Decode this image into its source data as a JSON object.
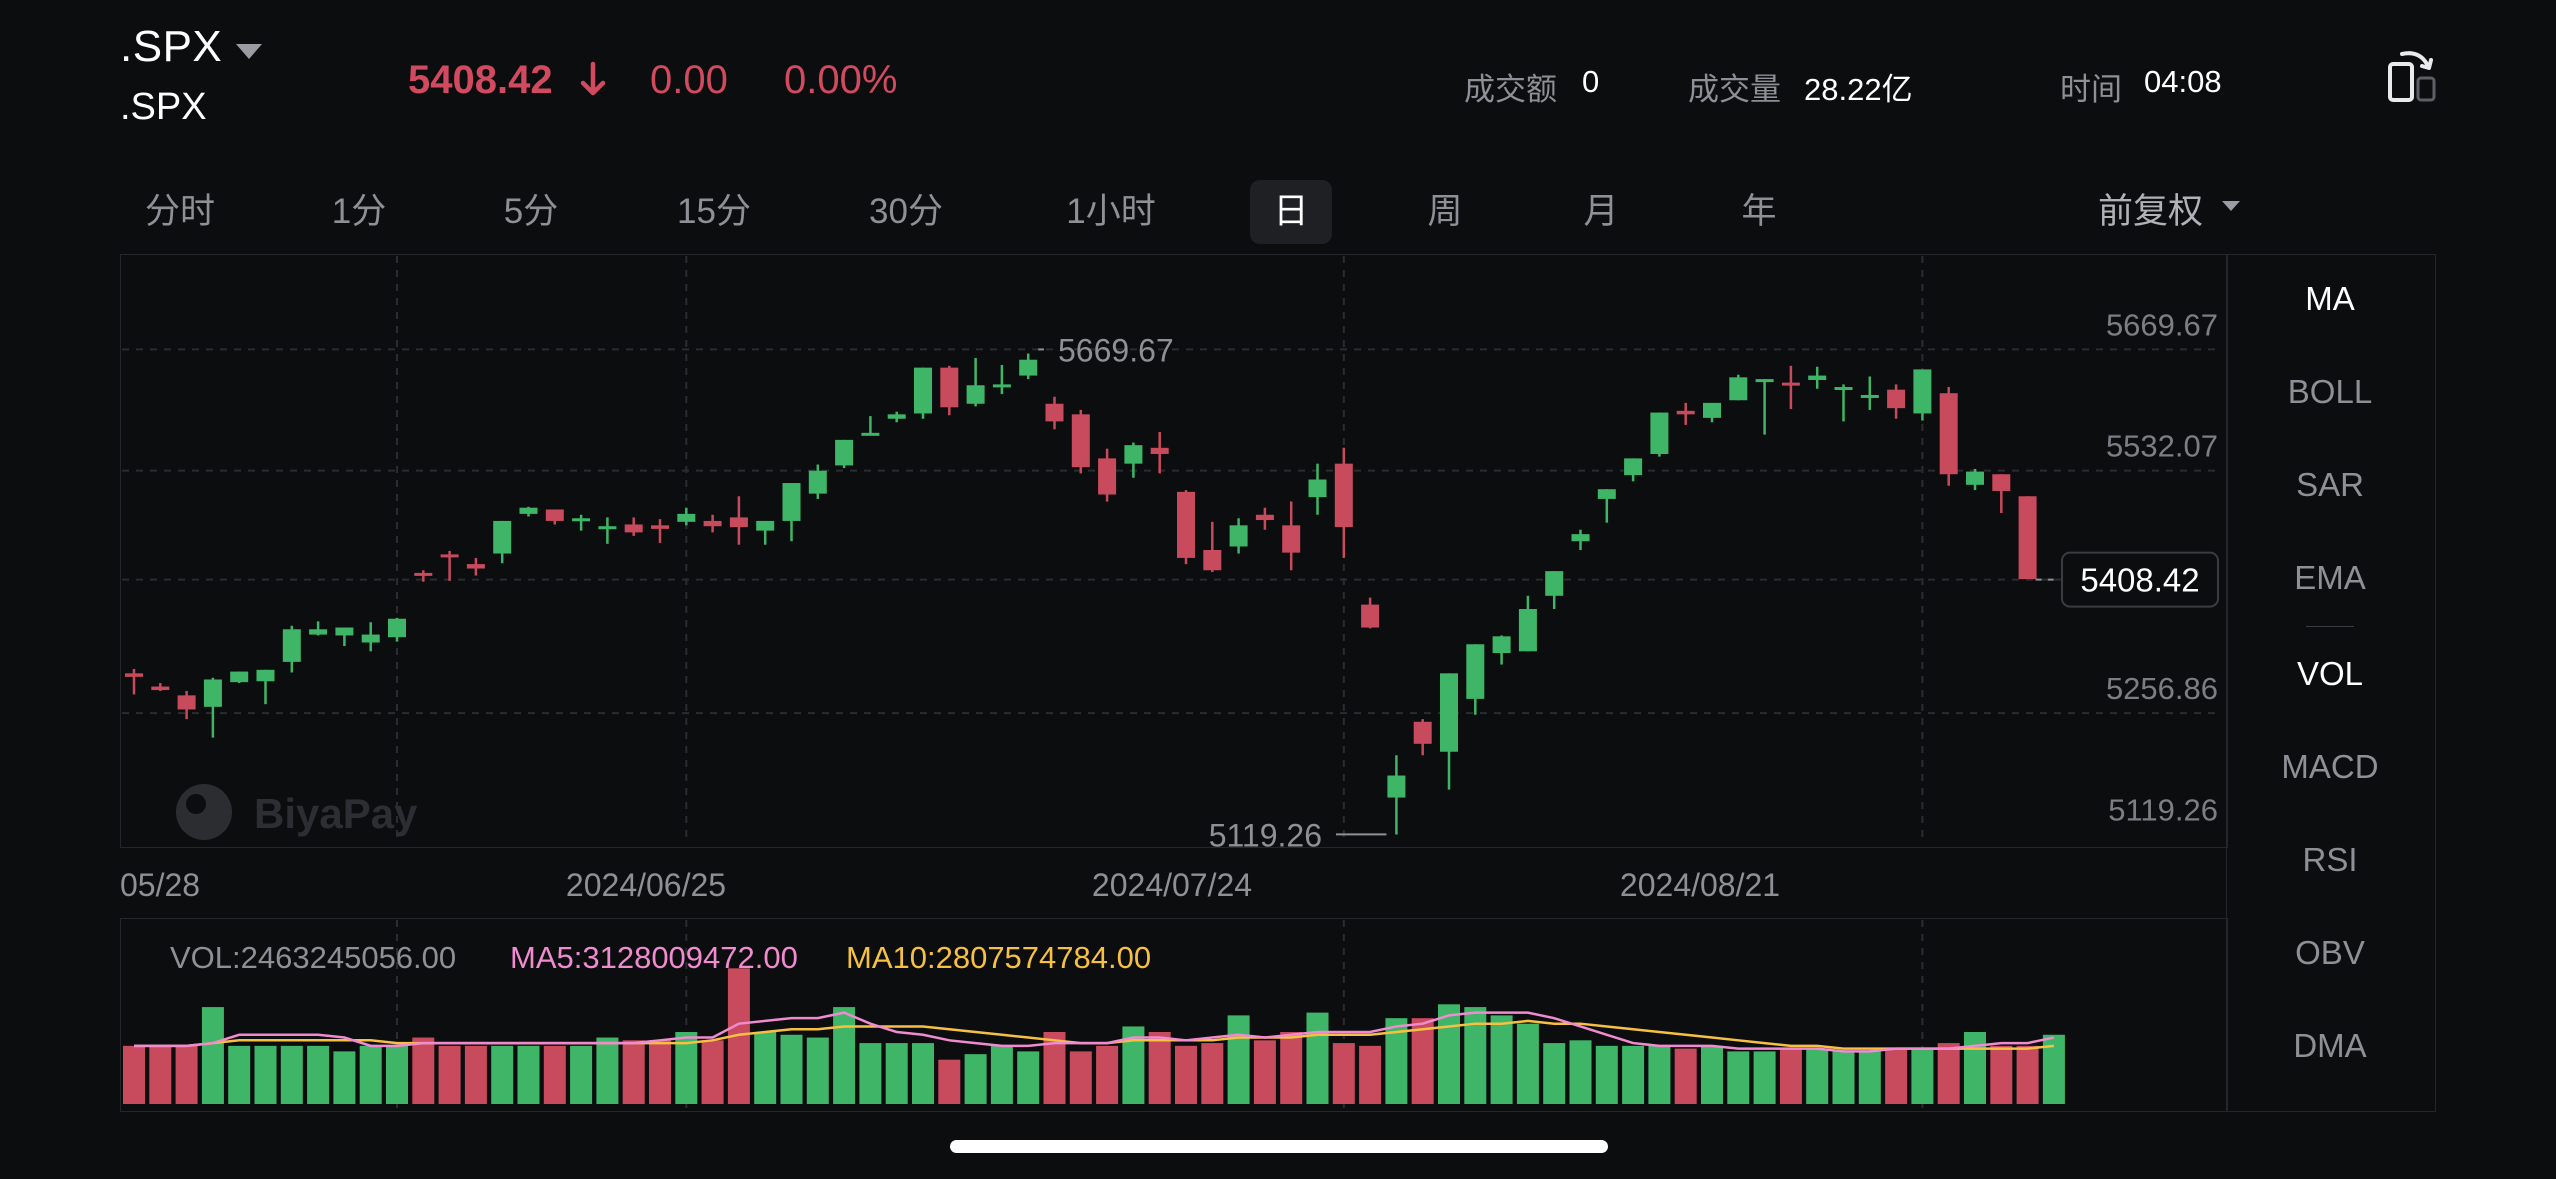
{
  "header": {
    "symbol": ".SPX",
    "symbol_sub": ".SPX",
    "price": "5408.42",
    "change": "0.00",
    "change_pct": "0.00%",
    "turnover_label": "成交额",
    "turnover_value": "0",
    "volume_label": "成交量",
    "volume_value": "28.22亿",
    "time_label": "时间",
    "time_value": "04:08"
  },
  "tabs": [
    {
      "label": "分时"
    },
    {
      "label": "1分"
    },
    {
      "label": "5分"
    },
    {
      "label": "15分"
    },
    {
      "label": "30分"
    },
    {
      "label": "1小时"
    },
    {
      "label": "日",
      "active": true
    },
    {
      "label": "周"
    },
    {
      "label": "月"
    },
    {
      "label": "年"
    }
  ],
  "adjust_label": "前复权",
  "indicators": {
    "main": [
      "MA",
      "BOLL",
      "SAR",
      "EMA"
    ],
    "sub": [
      "VOL",
      "MACD",
      "RSI",
      "OBV",
      "DMA"
    ]
  },
  "watermark": "BiyaPay",
  "vol_legend": {
    "vol": "VOL:2463245056.00",
    "ma5": "MA5:3128009472.00",
    "ma10": "MA10:2807574784.00"
  },
  "colors": {
    "up": "#3fb667",
    "down": "#c84a5d",
    "ma5": "#f08bd0",
    "ma10": "#f6c042",
    "background": "#0c0d0f"
  },
  "chart_data": {
    "type": "candlestick",
    "y_ticks": [
      "5669.67",
      "5532.07",
      "5408.42",
      "5256.86",
      "5119.26"
    ],
    "x_ticks": [
      "05/28",
      "2024/06/25",
      "2024/07/24",
      "2024/08/21"
    ],
    "high_marker": "5669.67",
    "low_marker": "5119.26",
    "last_price": "5408.42",
    "ylim": [
      5106,
      5778
    ],
    "candles": [
      [
        5302,
        5307,
        5278,
        5298
      ],
      [
        5287,
        5291,
        5282,
        5283
      ],
      [
        5277,
        5282,
        5250,
        5261
      ],
      [
        5264,
        5297,
        5229,
        5295
      ],
      [
        5292,
        5303,
        5291,
        5304
      ],
      [
        5293,
        5304,
        5267,
        5306
      ],
      [
        5315,
        5356,
        5303,
        5352
      ],
      [
        5346,
        5361,
        5345,
        5352
      ],
      [
        5345,
        5349,
        5333,
        5354
      ],
      [
        5337,
        5360,
        5327,
        5346
      ],
      [
        5343,
        5365,
        5338,
        5364
      ],
      [
        5416,
        5419,
        5406,
        5414
      ],
      [
        5437,
        5441,
        5407,
        5435
      ],
      [
        5426,
        5433,
        5413,
        5421
      ],
      [
        5438,
        5474,
        5427,
        5475
      ],
      [
        5483,
        5491,
        5480,
        5490
      ],
      [
        5488,
        5487,
        5471,
        5475
      ],
      [
        5477,
        5482,
        5464,
        5478
      ],
      [
        5466,
        5479,
        5449,
        5469
      ],
      [
        5471,
        5479,
        5458,
        5462
      ],
      [
        5470,
        5477,
        5450,
        5466
      ],
      [
        5474,
        5490,
        5470,
        5483
      ],
      [
        5475,
        5482,
        5462,
        5469
      ],
      [
        5479,
        5503,
        5448,
        5468
      ],
      [
        5464,
        5473,
        5448,
        5475
      ],
      [
        5475,
        5492,
        5452,
        5518
      ],
      [
        5506,
        5539,
        5500,
        5532
      ],
      [
        5538,
        5565,
        5535,
        5567
      ],
      [
        5574,
        5594,
        5585,
        5575
      ],
      [
        5591,
        5599,
        5587,
        5596
      ],
      [
        5597,
        5615,
        5591,
        5649
      ],
      [
        5649,
        5651,
        5595,
        5604
      ],
      [
        5608,
        5660,
        5605,
        5629
      ],
      [
        5630,
        5652,
        5619,
        5630
      ],
      [
        5640,
        5665,
        5636,
        5658
      ],
      [
        5608,
        5616,
        5579,
        5588
      ],
      [
        5596,
        5601,
        5529,
        5536
      ],
      [
        5546,
        5557,
        5497,
        5505
      ],
      [
        5540,
        5564,
        5524,
        5561
      ],
      [
        5558,
        5576,
        5529,
        5551
      ],
      [
        5508,
        5510,
        5426,
        5433
      ],
      [
        5442,
        5474,
        5417,
        5419
      ],
      [
        5446,
        5478,
        5438,
        5470
      ],
      [
        5482,
        5490,
        5465,
        5476
      ],
      [
        5470,
        5497,
        5419,
        5439
      ],
      [
        5502,
        5540,
        5482,
        5522
      ],
      [
        5540,
        5558,
        5433,
        5468
      ],
      [
        5380,
        5388,
        5353,
        5354
      ],
      [
        5161,
        5209,
        5119,
        5186
      ],
      [
        5247,
        5250,
        5209,
        5222
      ],
      [
        5213,
        5274,
        5170,
        5302
      ],
      [
        5273,
        5308,
        5255,
        5335
      ],
      [
        5325,
        5345,
        5312,
        5344
      ],
      [
        5327,
        5390,
        5331,
        5375
      ],
      [
        5390,
        5415,
        5375,
        5418
      ],
      [
        5452,
        5465,
        5442,
        5460
      ],
      [
        5500,
        5505,
        5473,
        5511
      ],
      [
        5527,
        5540,
        5520,
        5546
      ],
      [
        5551,
        5594,
        5548,
        5598
      ],
      [
        5600,
        5609,
        5584,
        5596
      ],
      [
        5592,
        5609,
        5587,
        5609
      ],
      [
        5612,
        5641,
        5613,
        5638
      ],
      [
        5634,
        5614,
        5573,
        5636
      ],
      [
        5632,
        5651,
        5602,
        5629
      ],
      [
        5635,
        5650,
        5625,
        5640
      ],
      [
        5626,
        5630,
        5588,
        5627
      ],
      [
        5618,
        5639,
        5601,
        5618
      ],
      [
        5624,
        5630,
        5591,
        5603
      ],
      [
        5597,
        5645,
        5589,
        5647
      ],
      [
        5620,
        5627,
        5515,
        5528
      ],
      [
        5516,
        5534,
        5510,
        5531
      ],
      [
        5528,
        5518,
        5484,
        5509
      ],
      [
        5503,
        5502,
        5417,
        5409
      ]
    ],
    "volume_values": [
      2.1,
      2.1,
      2.1,
      3.5,
      2.1,
      2.1,
      2.1,
      2.1,
      1.9,
      2.1,
      2.1,
      2.4,
      2.1,
      2.1,
      2.1,
      2.1,
      2.1,
      2.1,
      2.4,
      2.3,
      2.3,
      2.6,
      2.3,
      4.9,
      2.6,
      2.5,
      2.4,
      3.5,
      2.2,
      2.2,
      2.2,
      1.6,
      1.8,
      2.1,
      1.9,
      2.6,
      1.9,
      2.1,
      2.8,
      2.6,
      2.1,
      2.2,
      3.2,
      2.3,
      2.6,
      3.3,
      2.2,
      2.1,
      3.1,
      3.1,
      3.6,
      3.5,
      3.2,
      2.9,
      2.2,
      2.3,
      2.1,
      2.1,
      2.1,
      2.0,
      2.1,
      1.9,
      1.9,
      2.0,
      2.0,
      1.9,
      1.9,
      2.0,
      2.0,
      2.2,
      2.6,
      2.1,
      2.1,
      2.5
    ],
    "volume_ma5": [
      2.1,
      2.1,
      2.1,
      2.2,
      2.5,
      2.5,
      2.5,
      2.5,
      2.4,
      2.1,
      2.1,
      2.2,
      2.2,
      2.2,
      2.2,
      2.2,
      2.2,
      2.2,
      2.2,
      2.2,
      2.3,
      2.4,
      2.4,
      2.9,
      3.0,
      3.1,
      3.1,
      3.3,
      2.9,
      2.6,
      2.5,
      2.3,
      2.2,
      2.1,
      2.1,
      2.2,
      2.2,
      2.2,
      2.4,
      2.4,
      2.3,
      2.4,
      2.5,
      2.4,
      2.5,
      2.6,
      2.6,
      2.6,
      2.8,
      2.9,
      3.2,
      3.3,
      3.3,
      3.3,
      3.1,
      2.8,
      2.5,
      2.2,
      2.1,
      2.1,
      2.1,
      2.0,
      2.0,
      2.0,
      2.0,
      1.9,
      1.9,
      2.0,
      2.0,
      2.0,
      2.1,
      2.2,
      2.2,
      2.4
    ],
    "volume_ma10": [
      2.1,
      2.1,
      2.1,
      2.2,
      2.3,
      2.3,
      2.3,
      2.3,
      2.3,
      2.3,
      2.2,
      2.2,
      2.2,
      2.2,
      2.2,
      2.2,
      2.2,
      2.2,
      2.2,
      2.2,
      2.2,
      2.2,
      2.3,
      2.5,
      2.6,
      2.7,
      2.7,
      2.8,
      2.8,
      2.8,
      2.8,
      2.7,
      2.6,
      2.5,
      2.4,
      2.3,
      2.2,
      2.2,
      2.3,
      2.3,
      2.3,
      2.3,
      2.4,
      2.4,
      2.4,
      2.5,
      2.5,
      2.5,
      2.6,
      2.7,
      2.8,
      2.9,
      2.9,
      3.0,
      2.9,
      2.9,
      2.8,
      2.7,
      2.6,
      2.5,
      2.4,
      2.3,
      2.2,
      2.1,
      2.1,
      2.0,
      2.0,
      2.0,
      2.0,
      2.0,
      2.0,
      2.0,
      2.0,
      2.1
    ]
  }
}
